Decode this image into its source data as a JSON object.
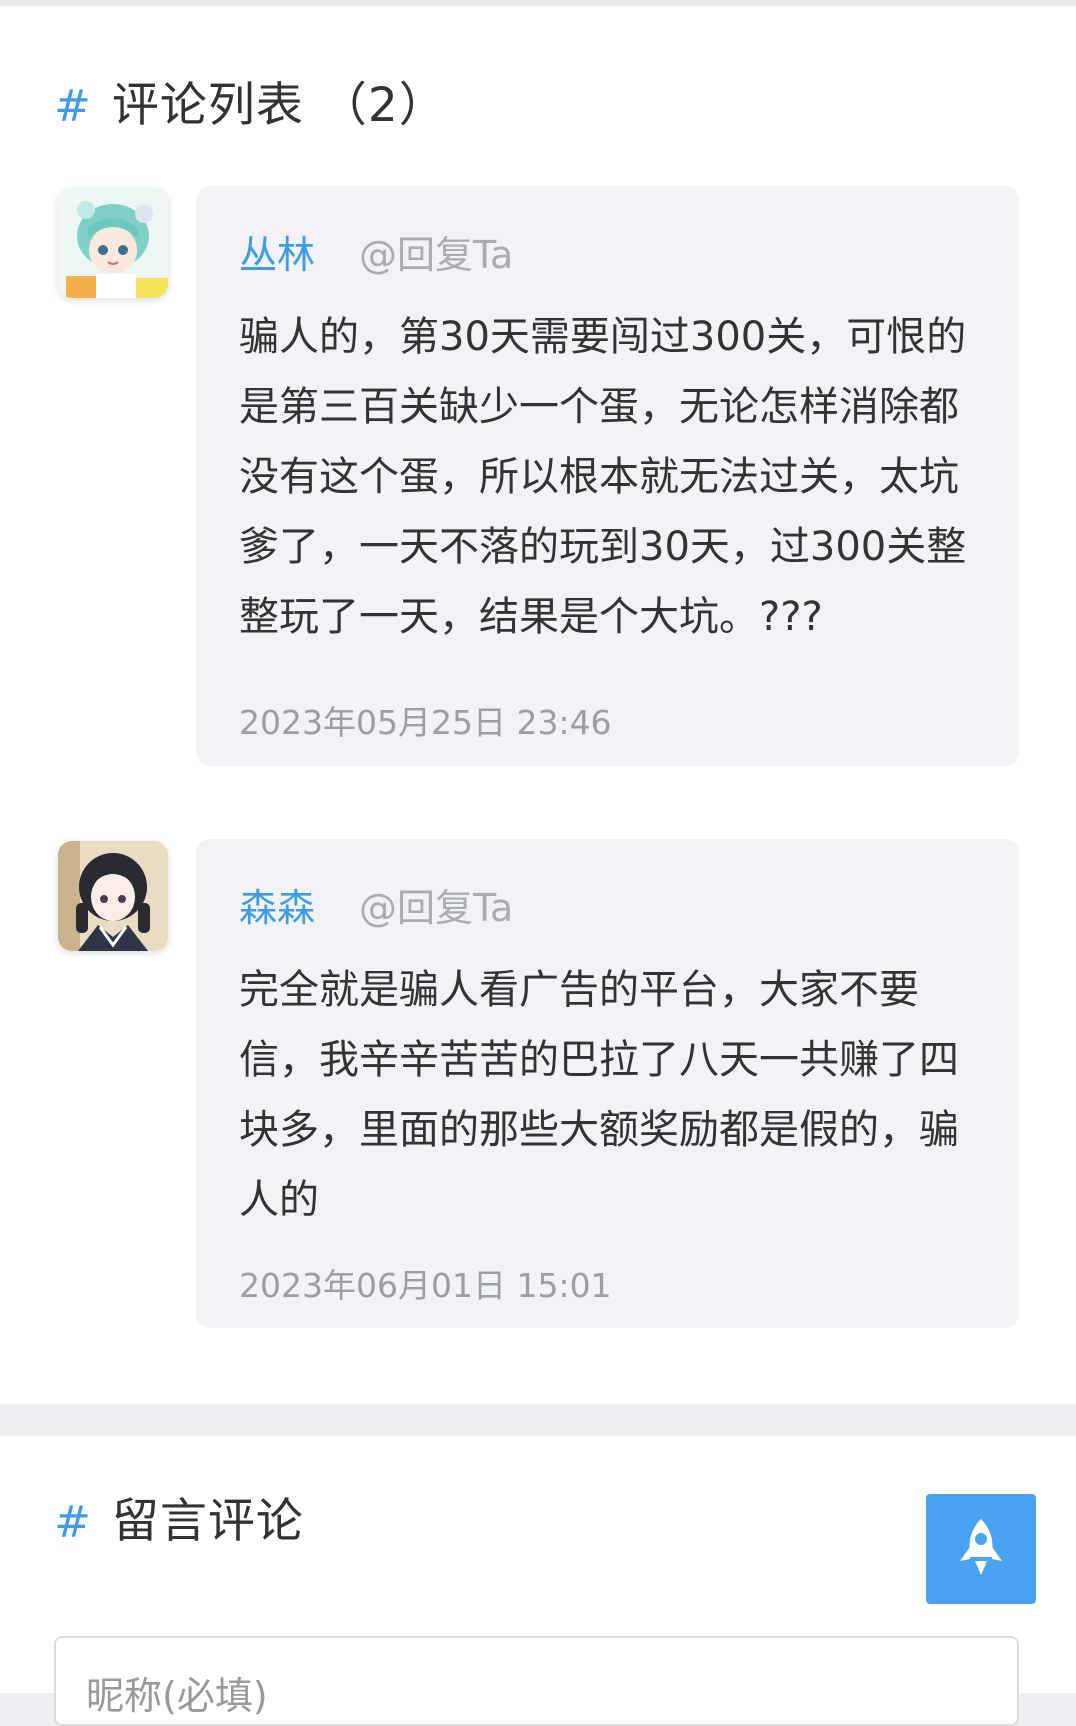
{
  "comment_section": {
    "hash": "#",
    "title": "评论列表 （2）"
  },
  "comments": [
    {
      "author": "丛林",
      "reply": "@回复Ta",
      "text": "骗人的，第30天需要闯过300关，可恨的是第三百关缺少一个蛋，无论怎样消除都没有这个蛋，所以根本就无法过关，太坑爹了，一天不落的玩到30天，过300关整整玩了一天，结果是个大坑。???",
      "time": "2023年05月25日 23:46"
    },
    {
      "author": "森森",
      "reply": "@回复Ta",
      "text": "完全就是骗人看广告的平台，大家不要信，我辛辛苦苦的巴拉了八天一共赚了四块多，里面的那些大额奖励都是假的，骗人的",
      "time": "2023年06月01日 15:01"
    }
  ],
  "form_section": {
    "hash": "#",
    "title": "留言评论",
    "nickname_placeholder": "昵称(必填)"
  },
  "colors": {
    "accent": "#3d9be9",
    "bubble": "#f1f3f7",
    "rocket_button": "#4aa3f0"
  },
  "icons": {
    "back_to_top": "rocket-icon"
  }
}
